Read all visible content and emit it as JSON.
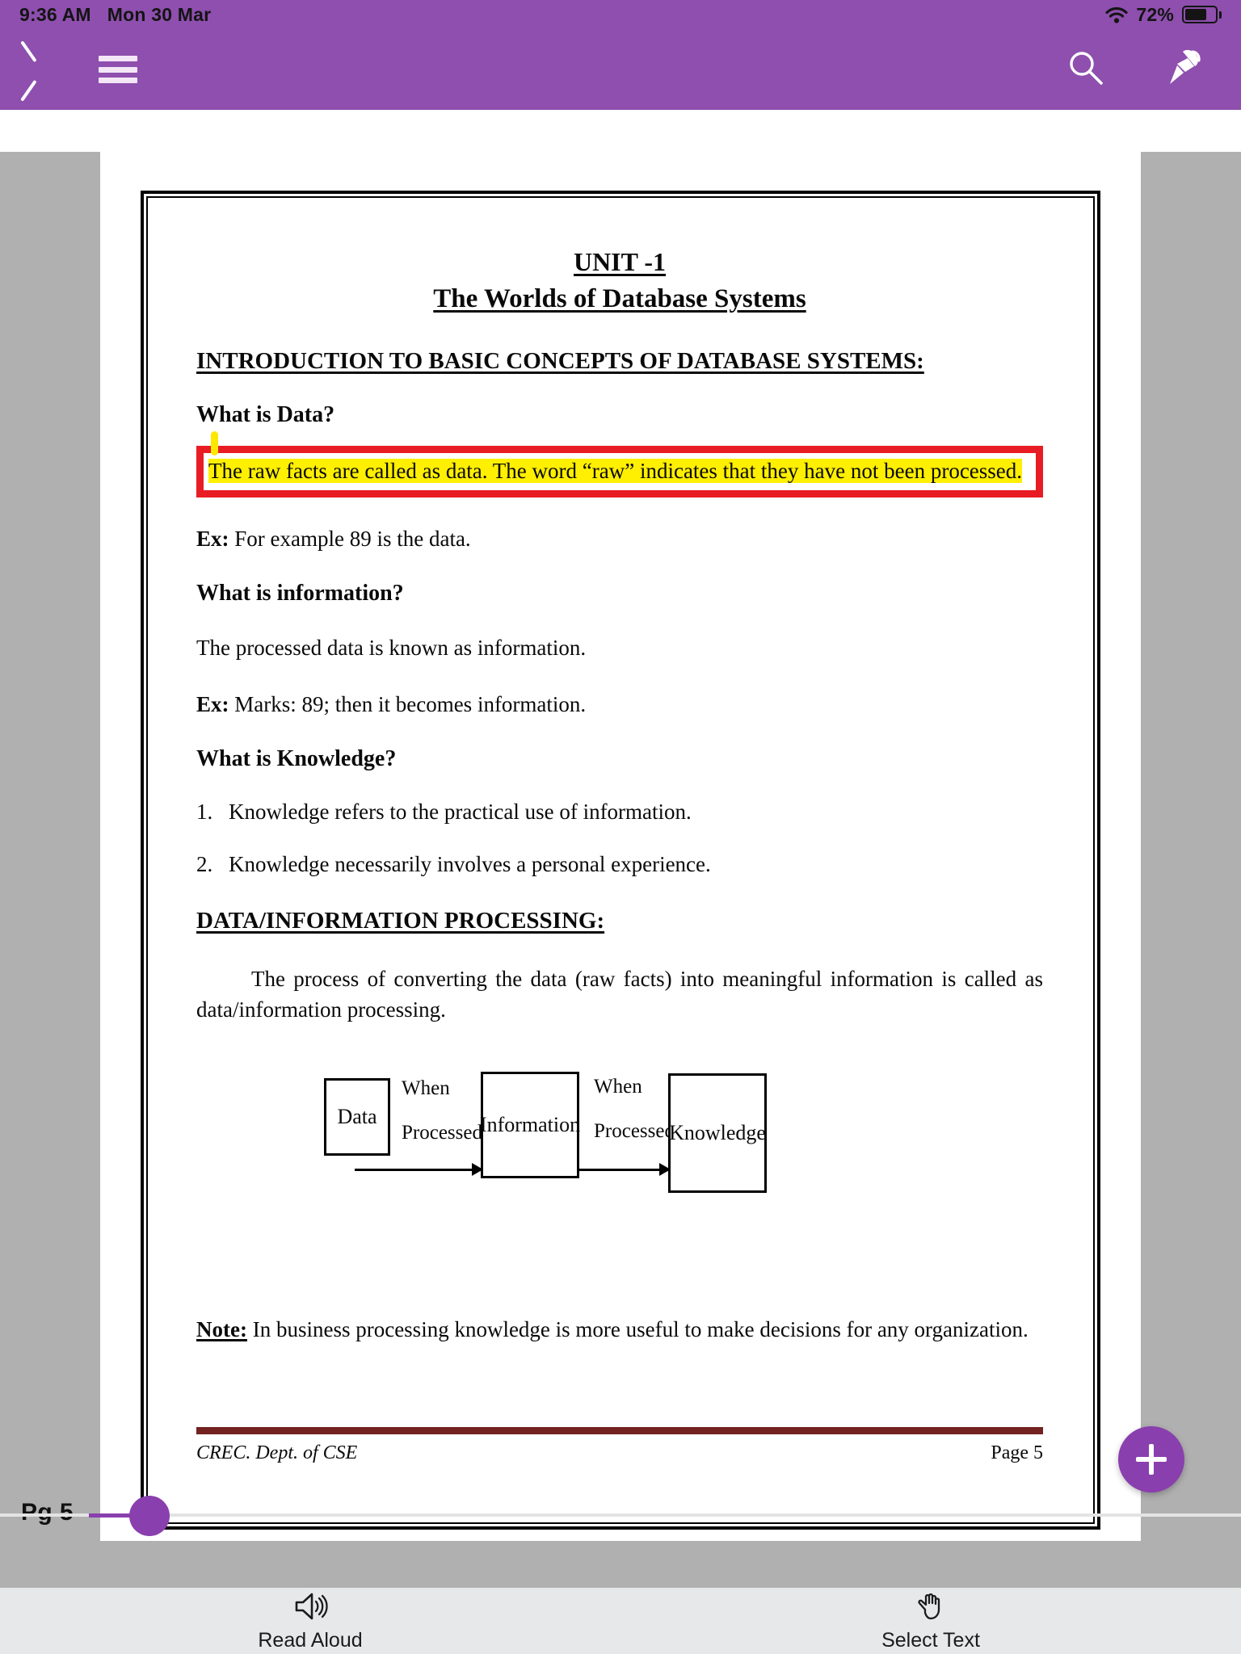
{
  "status_bar": {
    "time": "9:36 AM",
    "date": "Mon 30 Mar",
    "battery_percent": "72%",
    "wifi_icon": "wifi-icon",
    "battery_icon": "battery-icon"
  },
  "nav_bar": {
    "back_icon": "chevron-left-icon",
    "menu_icon": "hamburger-menu-icon",
    "search_icon": "search-icon",
    "pin_icon": "pushpin-icon",
    "accent_color": "#8e4fae"
  },
  "document": {
    "title_line1": "UNIT -1",
    "title_line2": "The Worlds of Database Systems",
    "section_intro": "INTRODUCTION TO BASIC CONCEPTS OF DATABASE SYSTEMS:",
    "q_data": "What is Data?",
    "highlight": {
      "text": "The raw facts are called as data. The word “raw” indicates that they have not been processed.",
      "highlight_color": "#ffef00",
      "box_color": "#e81c23"
    },
    "ex_data_label": "Ex:",
    "ex_data_text": " For example 89 is the data.",
    "q_information": "What is information?",
    "info_def": "The processed data is known as information.",
    "ex_info_label": "Ex:",
    "ex_info_text": " Marks: 89; then it becomes information.",
    "q_knowledge": "What is Knowledge?",
    "knowledge_points": [
      {
        "num": "1.",
        "text": "Knowledge refers to the practical use of information."
      },
      {
        "num": "2.",
        "text": "Knowledge necessarily involves a personal experience."
      }
    ],
    "section_processing": "DATA/INFORMATION PROCESSING:",
    "processing_text": "The process of converting the data (raw facts) into meaningful information is called as data/information processing.",
    "diagram": {
      "box1": "Data",
      "box2": "Information",
      "box3": "Knowledge",
      "label1_line1": "When",
      "label1_line2": "Processed",
      "label2_line1": "When",
      "label2_line2": "Processed"
    },
    "note_label": "Note:",
    "note_text": " In business processing knowledge is more useful to make decisions for any organization.",
    "footer_left": "CREC. Dept. of CSE",
    "footer_right": "Page 5",
    "footer_rule_color": "#722220"
  },
  "scrubber": {
    "page_label": "Pg 5",
    "handle_color": "#8a3fae"
  },
  "fab": {
    "icon": "plus-icon",
    "color": "#8a3fae"
  },
  "bottom_bar": {
    "read_aloud_label": "Read Aloud",
    "read_aloud_icon": "speaker-icon",
    "select_text_label": "Select Text",
    "select_text_icon": "hand-pointer-icon"
  }
}
